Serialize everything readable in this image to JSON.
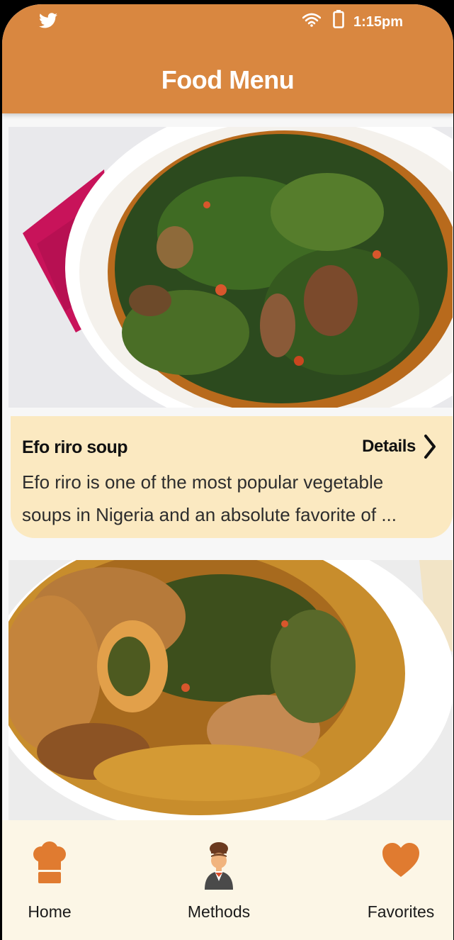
{
  "status_bar": {
    "time": "1:15pm",
    "icons": [
      "twitter-icon",
      "wifi-icon",
      "battery-icon"
    ]
  },
  "header": {
    "title": "Food Menu"
  },
  "cards": [
    {
      "image": "efo-riro-soup-photo",
      "name": "Efo riro soup",
      "details_label": "Details",
      "description": "Efo riro is one of the most popular vegetable soups in Nigeria and an absolute favorite of ..."
    },
    {
      "image": "vegetable-stew-photo"
    }
  ],
  "bottom_nav": {
    "items": [
      {
        "label": "Home",
        "icon": "chef-hat-icon"
      },
      {
        "label": "Methods",
        "icon": "chef-icon"
      },
      {
        "label": "Favorites",
        "icon": "heart-icon"
      }
    ]
  },
  "colors": {
    "header": "#d98740",
    "card_info_bg": "#fbe9c1",
    "bottom_nav_bg": "#fcf6e6",
    "accent": "#e07b30"
  }
}
